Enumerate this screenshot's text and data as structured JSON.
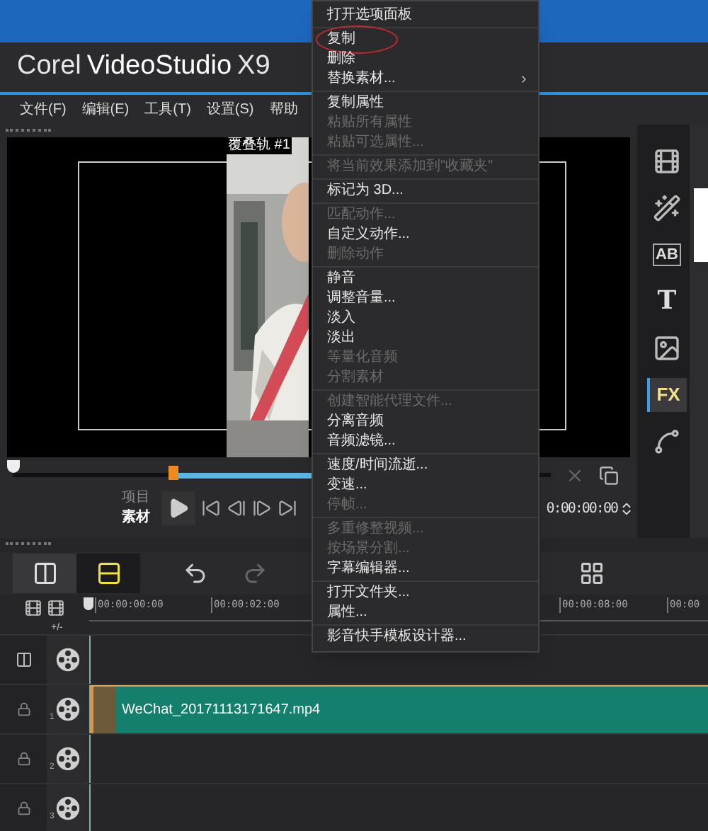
{
  "title": {
    "brand": "Corel",
    "product": "VideoStudio",
    "version": "X9"
  },
  "menu_bar": [
    {
      "label": "文件(F)"
    },
    {
      "label": "编辑(E)"
    },
    {
      "label": "工具(T)"
    },
    {
      "label": "设置(S)"
    },
    {
      "label": "帮助"
    }
  ],
  "preview": {
    "track_label": "覆叠轨 #1"
  },
  "playback": {
    "modes": [
      {
        "label": "项目",
        "selected": false
      },
      {
        "label": "素材",
        "selected": true
      }
    ],
    "timecode": "0:00:00:00"
  },
  "library_tabs": [
    {
      "kind": "media",
      "selected": false
    },
    {
      "kind": "instant",
      "selected": false
    },
    {
      "kind": "transition",
      "label": "AB",
      "selected": false
    },
    {
      "kind": "title",
      "label": "T",
      "selected": false
    },
    {
      "kind": "graphic",
      "selected": false
    },
    {
      "kind": "filter",
      "label": "FX",
      "selected": true
    },
    {
      "kind": "path",
      "selected": false
    }
  ],
  "timeline": {
    "view_buttons": [
      {
        "kind": "storyboard",
        "selected": false
      },
      {
        "kind": "timeline",
        "selected": true
      }
    ],
    "ruler": [
      "00:00:00:00",
      "00:00:02:00",
      "00:00:08:00",
      "00:00"
    ],
    "track_toggle": "+/-",
    "tracks": [
      {
        "kind": "video"
      },
      {
        "kind": "overlay",
        "number": "1",
        "clip": "WeChat_20171113171647.mp4"
      },
      {
        "kind": "overlay",
        "number": "2"
      },
      {
        "kind": "overlay",
        "number": "3"
      }
    ]
  },
  "context_menu": {
    "groups": [
      [
        {
          "label": "打开选项面板",
          "disabled": false,
          "circled": false
        }
      ],
      [
        {
          "label": "复制",
          "disabled": false,
          "circled": true
        },
        {
          "label": "删除",
          "disabled": false,
          "circled": false
        },
        {
          "label": "替换素材...",
          "disabled": false,
          "circled": false,
          "submenu": true
        }
      ],
      [
        {
          "label": "复制属性",
          "disabled": false,
          "circled": false
        },
        {
          "label": "粘贴所有属性",
          "disabled": true,
          "circled": false
        },
        {
          "label": "粘贴可选属性...",
          "disabled": true,
          "circled": false
        }
      ],
      [
        {
          "label": "将当前效果添加到\"收藏夹\"",
          "disabled": true,
          "circled": false
        }
      ],
      [
        {
          "label": "标记为 3D...",
          "disabled": false,
          "circled": false
        }
      ],
      [
        {
          "label": "匹配动作...",
          "disabled": true,
          "circled": false
        },
        {
          "label": "自定义动作...",
          "disabled": false,
          "circled": false
        },
        {
          "label": "删除动作",
          "disabled": true,
          "circled": false
        }
      ],
      [
        {
          "label": "静音",
          "disabled": false,
          "circled": false
        },
        {
          "label": "调整音量...",
          "disabled": false,
          "circled": false
        },
        {
          "label": "淡入",
          "disabled": false,
          "circled": false
        },
        {
          "label": "淡出",
          "disabled": false,
          "circled": false
        },
        {
          "label": "等量化音频",
          "disabled": true,
          "circled": false
        },
        {
          "label": "分割素材",
          "disabled": true,
          "circled": false
        }
      ],
      [
        {
          "label": "创建智能代理文件...",
          "disabled": true,
          "circled": false
        },
        {
          "label": "分离音频",
          "disabled": false,
          "circled": false
        },
        {
          "label": "音频滤镜...",
          "disabled": false,
          "circled": false
        }
      ],
      [
        {
          "label": "速度/时间流逝...",
          "disabled": false,
          "circled": false
        },
        {
          "label": "变速...",
          "disabled": false,
          "circled": false
        },
        {
          "label": "停帧...",
          "disabled": true,
          "circled": false
        }
      ],
      [
        {
          "label": "多重修整视频...",
          "disabled": true,
          "circled": false
        },
        {
          "label": "按场景分割...",
          "disabled": true,
          "circled": false
        },
        {
          "label": "字幕编辑器...",
          "disabled": false,
          "circled": false
        }
      ],
      [
        {
          "label": "打开文件夹...",
          "disabled": false,
          "circled": false
        },
        {
          "label": "属性...",
          "disabled": false,
          "circled": false
        }
      ],
      [
        {
          "label": "影音快手模板设计器...",
          "disabled": false,
          "circled": false
        }
      ]
    ]
  }
}
